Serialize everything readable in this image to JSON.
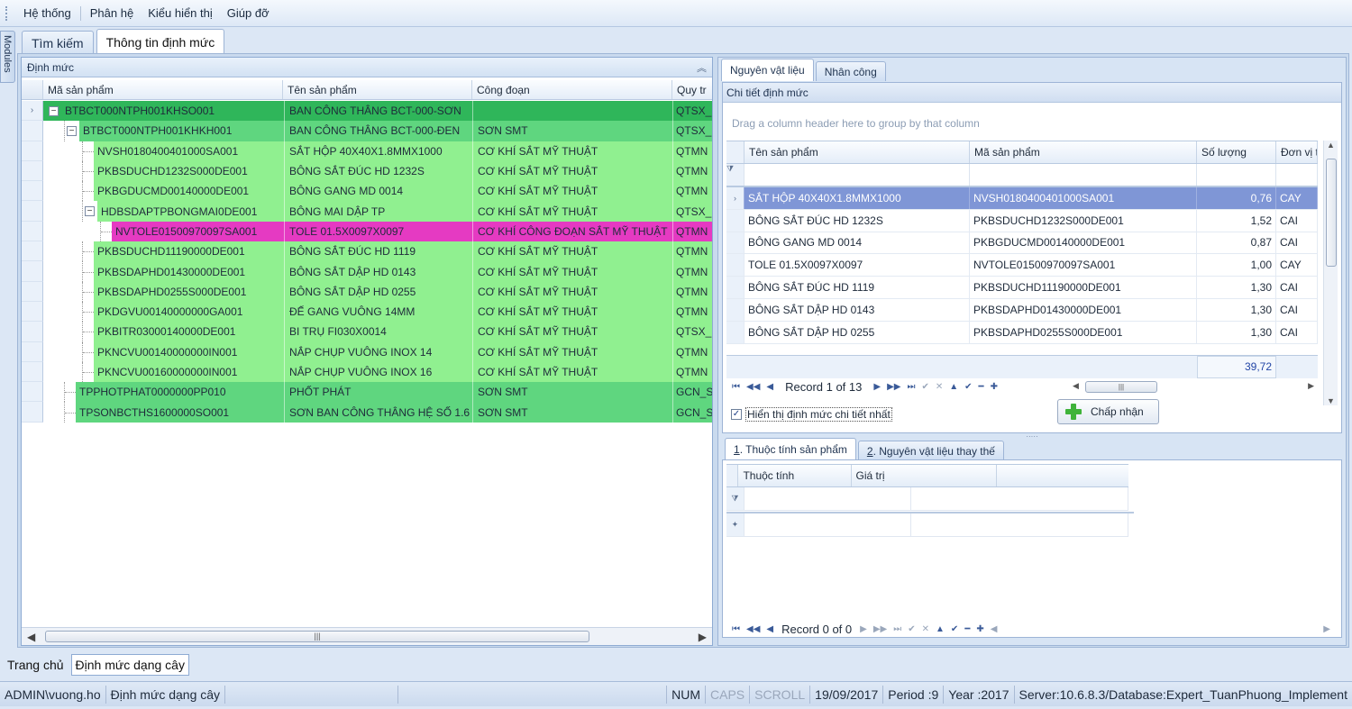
{
  "menu": [
    "Hệ thống",
    "Phân hệ",
    "Kiểu hiển thị",
    "Giúp đỡ"
  ],
  "modules_label": "Modules",
  "doc_tabs": [
    "Tìm kiếm",
    "Thông tin định mức"
  ],
  "left_panel": {
    "title": "Định mức",
    "columns": [
      "Mã sản phẩm",
      "Tên sản phẩm",
      "Công đoạn",
      "Quy tr"
    ],
    "rows": [
      {
        "code": "BTBCT000NTPH001KHSO001",
        "name": "BAN CÔNG THÂNG BCT-000-SƠN",
        "stage": "",
        "proc": "QTSX_"
      },
      {
        "code": "BTBCT000NTPH001KHKH001",
        "name": "BAN CÔNG THÂNG BCT-000-ĐEN",
        "stage": "SƠN SMT",
        "proc": "QTSX_("
      },
      {
        "code": "NVSH0180400401000SA001",
        "name": "SẮT HỘP 40X40X1.8MMX1000",
        "stage": "CƠ KHÍ SẮT MỸ THUẬT",
        "proc": "QTMN"
      },
      {
        "code": "PKBSDUCHD1232S000DE001",
        "name": "BÔNG SẮT ĐÚC HD 1232S",
        "stage": "CƠ KHÍ SẮT MỸ THUẬT",
        "proc": "QTMN"
      },
      {
        "code": "PKBGDUCMD00140000DE001",
        "name": "BÔNG GANG MD 0014",
        "stage": "CƠ KHÍ SẮT MỸ THUẬT",
        "proc": "QTMN"
      },
      {
        "code": "HDBSDAPTPBONGMAI0DE001",
        "name": "BÔNG MAI DẬP TP",
        "stage": "CƠ KHÍ SẮT MỸ THUẬT",
        "proc": "QTSX_("
      },
      {
        "code": "NVTOLE01500970097SA001",
        "name": "TOLE 01.5X0097X0097",
        "stage": "CƠ KHÍ CÔNG ĐOẠN SẮT MỸ THUẬT",
        "proc": "QTMN"
      },
      {
        "code": "PKBSDUCHD11190000DE001",
        "name": "BÔNG SẮT ĐÚC HD 1119",
        "stage": "CƠ KHÍ SẮT MỸ THUẬT",
        "proc": "QTMN"
      },
      {
        "code": "PKBSDAPHD01430000DE001",
        "name": "BÔNG SẮT DẬP HD 0143",
        "stage": "CƠ KHÍ SẮT MỸ THUẬT",
        "proc": "QTMN"
      },
      {
        "code": "PKBSDAPHD0255S000DE001",
        "name": "BÔNG SẮT DẬP HD 0255",
        "stage": "CƠ KHÍ SẮT MỸ THUẬT",
        "proc": "QTMN"
      },
      {
        "code": "PKDGVU00140000000GA001",
        "name": "ĐẾ GANG VUÔNG 14MM",
        "stage": "CƠ KHÍ SẮT MỸ THUẬT",
        "proc": "QTMN"
      },
      {
        "code": "PKBITR03000140000DE001",
        "name": "BI TRỤ FI030X0014",
        "stage": "CƠ KHÍ SẮT MỸ THUẬT",
        "proc": "QTSX_("
      },
      {
        "code": "PKNCVU00140000000IN001",
        "name": "NẮP CHỤP VUÔNG INOX 14",
        "stage": "CƠ KHÍ SẮT MỸ THUẬT",
        "proc": "QTMN"
      },
      {
        "code": "PKNCVU00160000000IN001",
        "name": "NẮP CHỤP VUÔNG INOX 16",
        "stage": "CƠ KHÍ SẮT MỸ THUẬT",
        "proc": "QTMN"
      },
      {
        "code": "TPPHOTPHAT0000000PP010",
        "name": "PHỐT PHÁT",
        "stage": "SƠN SMT",
        "proc": "GCN_S"
      },
      {
        "code": "TPSONBCTHS1600000SO001",
        "name": "SƠN BAN CÔNG THÂNG HỆ SỐ 1.6",
        "stage": "SƠN SMT",
        "proc": "GCN_S"
      }
    ]
  },
  "right_tabs": [
    "Nguyên vật liệu",
    "Nhân công"
  ],
  "detail": {
    "title": "Chi tiết định mức",
    "group_hint": "Drag a column header here to group by that column",
    "columns": [
      "Tên sản phẩm",
      "Mã sản phẩm",
      "Số lượng",
      "Đơn vị t"
    ],
    "rows": [
      {
        "name": "SẮT HỘP 40X40X1.8MMX1000",
        "code": "NVSH0180400401000SA001",
        "qty": "0,76",
        "unit": "CAY"
      },
      {
        "name": "BÔNG SẮT ĐÚC HD 1232S",
        "code": "PKBSDUCHD1232S000DE001",
        "qty": "1,52",
        "unit": "CAI"
      },
      {
        "name": "BÔNG GANG MD 0014",
        "code": "PKBGDUCMD00140000DE001",
        "qty": "0,87",
        "unit": "CAI"
      },
      {
        "name": "TOLE 01.5X0097X0097",
        "code": "NVTOLE01500970097SA001",
        "qty": "1,00",
        "unit": "CAY"
      },
      {
        "name": "BÔNG SẮT ĐÚC HD 1119",
        "code": "PKBSDUCHD11190000DE001",
        "qty": "1,30",
        "unit": "CAI"
      },
      {
        "name": "BÔNG SẮT DẬP HD 0143",
        "code": "PKBSDAPHD01430000DE001",
        "qty": "1,30",
        "unit": "CAI"
      },
      {
        "name": "BÔNG SẮT DẬP HD 0255",
        "code": "PKBSDAPHD0255S000DE001",
        "qty": "1,30",
        "unit": "CAI"
      }
    ],
    "total": "39,72",
    "record": "Record 1 of 13",
    "checkbox_label": "Hiển thị định mức chi tiết nhất",
    "accept_label": "Chấp nhận"
  },
  "bottom_tabs": [
    {
      "num": "1",
      "text": ". Thuộc tính sản phẩm"
    },
    {
      "num": "2",
      "text": ". Nguyên vật liệu thay thế"
    }
  ],
  "attr": {
    "columns": [
      "Thuộc tính",
      "Giá trị"
    ],
    "record": "Record 0 of 0"
  },
  "page_tabs": [
    "Trang chủ",
    "Định mức dạng cây"
  ],
  "status": {
    "user": "ADMIN\\vuong.ho",
    "form": "Định mức dạng cây",
    "num": "NUM",
    "caps": "CAPS",
    "scroll": "SCROLL",
    "date": "19/09/2017",
    "period": "Period :9",
    "year": "Year :2017",
    "server": "Server:10.6.8.3/Database:Expert_TuanPhuong_Implement"
  },
  "colors": {
    "row_root": "#2fb65a",
    "row_level1": "#5fd67f",
    "row_level2": "#90f090",
    "row_selected": "#e53ac2",
    "grid_selection": "#7f96d6"
  }
}
